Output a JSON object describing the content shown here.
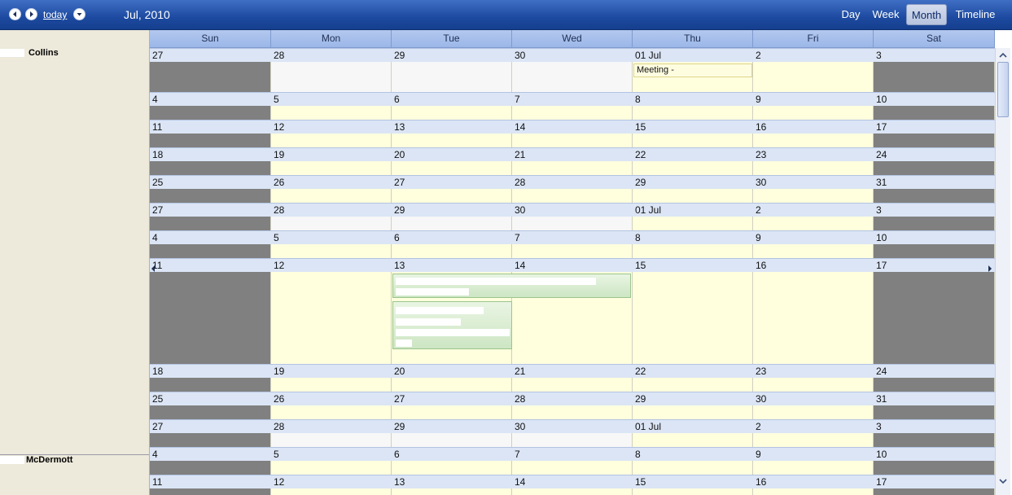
{
  "toolbar": {
    "today_label": "today",
    "month_title": "Jul, 2010",
    "views": [
      "Day",
      "Week",
      "Month",
      "Timeline"
    ],
    "active_view": "Month"
  },
  "weekday_headers": [
    "Sun",
    "Mon",
    "Tue",
    "Wed",
    "Thu",
    "Fri",
    "Sat"
  ],
  "resources": [
    " Collins",
    "McDermott"
  ],
  "weeks": [
    [
      "27",
      "28",
      "29",
      "30",
      "01 Jul",
      "2",
      "3"
    ],
    [
      "4",
      "5",
      "6",
      "7",
      "8",
      "9",
      "10"
    ],
    [
      "11",
      "12",
      "13",
      "14",
      "15",
      "16",
      "17"
    ],
    [
      "18",
      "19",
      "20",
      "21",
      "22",
      "23",
      "24"
    ],
    [
      "25",
      "26",
      "27",
      "28",
      "29",
      "30",
      "31"
    ],
    [
      "27",
      "28",
      "29",
      "30",
      "01 Jul",
      "2",
      "3"
    ],
    [
      "4",
      "5",
      "6",
      "7",
      "8",
      "9",
      "10"
    ],
    [
      "11",
      "12",
      "13",
      "14",
      "15",
      "16",
      "17"
    ],
    [
      "18",
      "19",
      "20",
      "21",
      "22",
      "23",
      "24"
    ],
    [
      "25",
      "26",
      "27",
      "28",
      "29",
      "30",
      "31"
    ],
    [
      "27",
      "28",
      "29",
      "30",
      "01 Jul",
      "2",
      "3"
    ],
    [
      "4",
      "5",
      "6",
      "7",
      "8",
      "9",
      "10"
    ],
    [
      "11",
      "12",
      "13",
      "14",
      "15",
      "16",
      "17"
    ]
  ],
  "events": {
    "meeting_label": "Meeting -"
  },
  "colors": {
    "weekend": "#808080",
    "in_month": "#ffffde",
    "out_month": "#f7f7f7",
    "week_label": "#dbe5f5",
    "toolbar": "#1d4aa0"
  }
}
